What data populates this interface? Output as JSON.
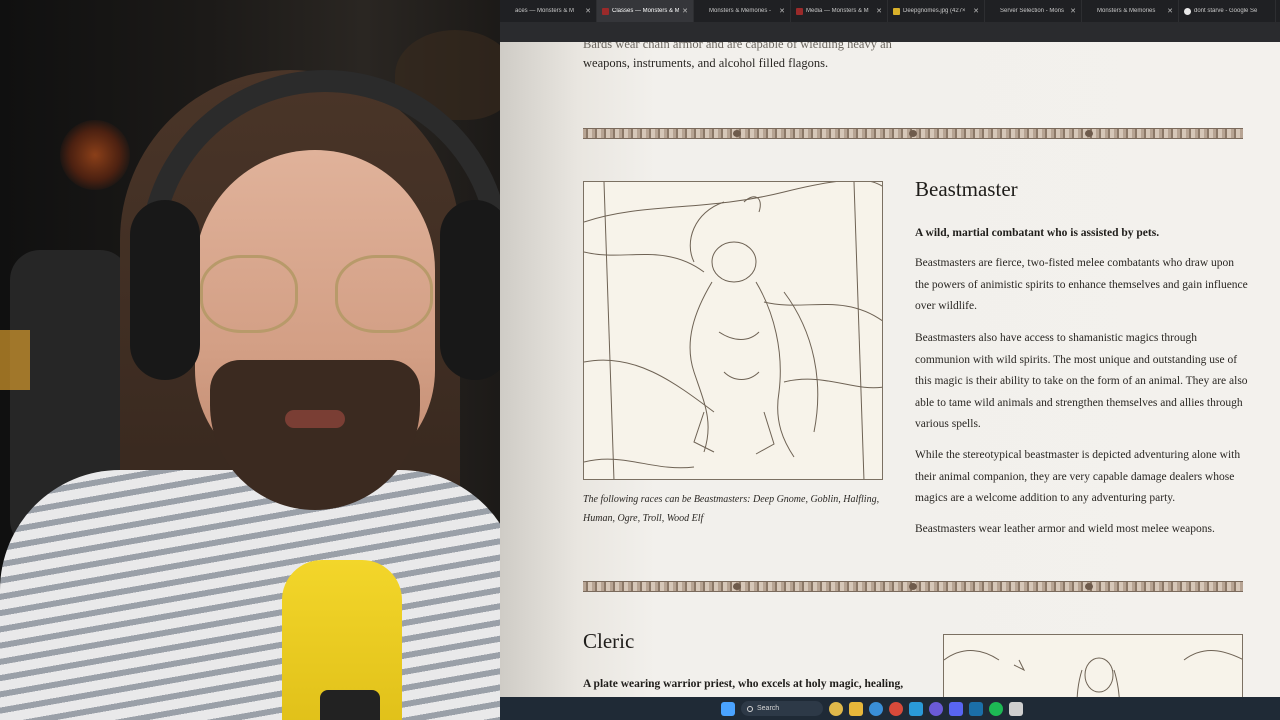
{
  "browser": {
    "tabs": [
      {
        "label": "aces — Monsters & M",
        "favicon": "none",
        "active": false
      },
      {
        "label": "Classes — Monsters & M",
        "favicon": "mm-logo-icon",
        "active": true
      },
      {
        "label": "Monsters & Memories -",
        "favicon": "none",
        "active": false
      },
      {
        "label": "Media — Monsters & M",
        "favicon": "mm-logo-icon",
        "active": false
      },
      {
        "label": "Deepgnomes.jpg (427×",
        "favicon": "image-icon",
        "active": false
      },
      {
        "label": "Server Selection - Mons",
        "favicon": "none",
        "active": false
      },
      {
        "label": "Monsters & Memories",
        "favicon": "none",
        "active": false
      },
      {
        "label": "dont starve - Google Se",
        "favicon": "google-icon",
        "active": false
      }
    ],
    "close_glyph": "✕"
  },
  "page": {
    "prev_section_line0": "Bards wear chain armor and are capable of wielding heavy an",
    "prev_section_line1": "weapons, instruments, and alcohol filled flagons.",
    "beastmaster": {
      "title": "Beastmaster",
      "tagline": "A wild, martial combatant who is assisted by pets.",
      "paragraphs": [
        "Beastmasters are fierce, two-fisted melee combatants who draw upon the powers of animistic spirits to enhance themselves and gain influence over wildlife.",
        "Beastmasters also have access to shamanistic magics through communion with wild spirits. The most unique and outstanding use of this magic is their ability to take on the form of an animal. They are also able to tame wild animals and strengthen themselves and allies through various spells.",
        "While the stereotypical beastmaster is depicted adventuring alone with their animal companion, they are very capable damage dealers whose magics are a welcome addition to any adventuring party.",
        "Beastmasters wear leather armor and wield most melee weapons."
      ],
      "caption": "The following races can be Beastmasters: Deep Gnome, Goblin, Halfling, Human, Ogre, Troll, Wood Elf"
    },
    "cleric": {
      "title": "Cleric",
      "tagline_bold": "A plate wearing warrior priest, who excels at holy magic, healing,"
    }
  },
  "taskbar": {
    "search_label": "Search",
    "icons": [
      "windows-start-icon",
      "weather-icon",
      "file-explorer-icon",
      "chrome-icon",
      "chrome-alt-icon",
      "edge-icon",
      "obs-icon",
      "discord-icon",
      "steam-icon",
      "spotify-icon",
      "app-icon"
    ],
    "colors": {
      "start": "#4aa3ff",
      "weather": "#e0b84a",
      "explorer": "#e8b73a",
      "chrome": "#3a8fd8",
      "chrome_alt": "#d84a3a",
      "edge": "#2a9ad8",
      "obs": "#6a5ad8",
      "discord": "#5865f2",
      "steam": "#1b6fa8",
      "spotify": "#1db954",
      "app": "#cfcfcf"
    }
  },
  "colors": {
    "page_bg": "#f3f1ed",
    "divider": "#8b7867",
    "text": "#1f1d1a"
  }
}
